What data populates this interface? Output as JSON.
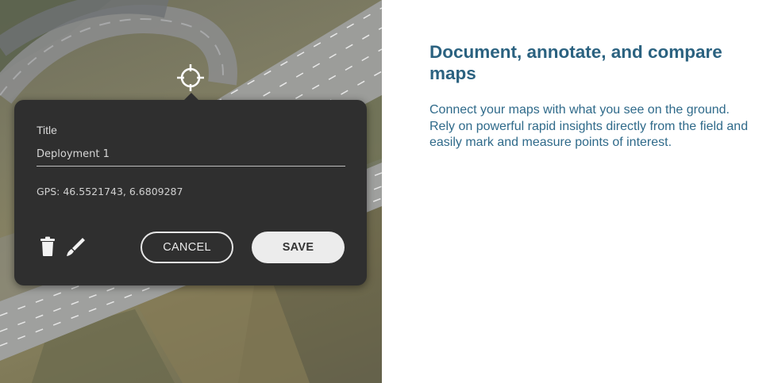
{
  "popup": {
    "title_label": "Title",
    "title_value": "Deployment 1",
    "gps_label": "GPS:",
    "gps_value": "46.5521743, 6.6809287",
    "cancel_label": "CANCEL",
    "save_label": "SAVE",
    "delete_icon": "trash-icon",
    "edit_icon": "pencil-icon"
  },
  "marker": {
    "icon": "crosshair-icon"
  },
  "panel": {
    "heading": "Document, annotate, and compare maps",
    "body": "Connect your maps with what you see on the ground. Rely on powerful rapid insights directly from the field and easily mark and measure points of interest."
  },
  "colors": {
    "heading": "#2b6280",
    "body_text": "#2f6a8a",
    "popup_bg": "#2f2f2f",
    "save_button": "#ececec"
  }
}
